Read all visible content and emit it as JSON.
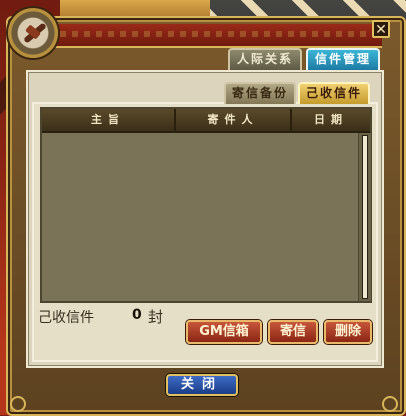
{
  "window": {
    "close_glyph": "✕"
  },
  "outer_tabs": [
    {
      "label": "人际关系",
      "active": false
    },
    {
      "label": "信件管理",
      "active": true
    }
  ],
  "inner_tabs": [
    {
      "label": "寄信备份",
      "active": false
    },
    {
      "label": "己收信件",
      "active": true
    }
  ],
  "list": {
    "columns": [
      "主旨",
      "寄件人",
      "日期"
    ],
    "rows": []
  },
  "footer": {
    "count_label": "己收信件",
    "count_value": "0",
    "count_unit": "封",
    "gm_button": "GM信箱",
    "send_button": "寄信",
    "delete_button": "删除",
    "close_button": "关闭"
  },
  "colors": {
    "active_outer_tab": "#1d7aa3",
    "active_inner_tab": "#c49a2c",
    "action_button": "#8a2614",
    "close_button": "#1c3d86"
  },
  "icons": [
    "compass-emblem-icon",
    "close-icon"
  ]
}
